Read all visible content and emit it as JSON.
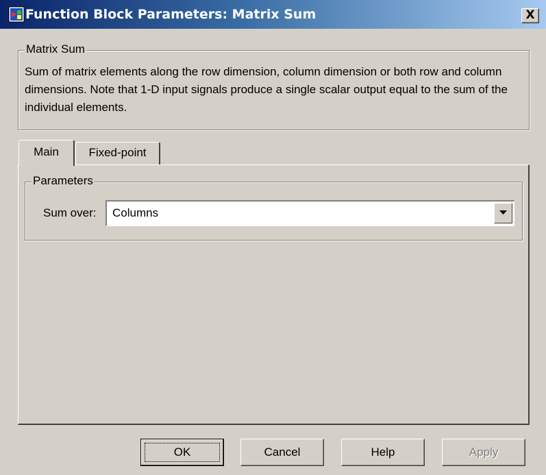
{
  "window": {
    "title": "Function Block Parameters: Matrix Sum",
    "icon": "simulink-block-icon",
    "close_label": "X",
    "colors": {
      "titlebar_start": "#0a246a",
      "titlebar_end": "#a6caf0",
      "face": "#d4d0c8"
    }
  },
  "description_group": {
    "legend": "Matrix Sum",
    "text": "Sum of matrix elements along the row dimension, column dimension or both row and column dimensions. Note that 1-D input signals produce a single scalar output equal to the sum of the individual elements."
  },
  "tabs": [
    {
      "label": "Main",
      "active": true
    },
    {
      "label": "Fixed-point",
      "active": false
    }
  ],
  "parameters": {
    "legend": "Parameters",
    "sum_over_label": "Sum over:",
    "sum_over_value": "Columns"
  },
  "buttons": {
    "ok": "OK",
    "cancel": "Cancel",
    "help": "Help",
    "apply": "Apply"
  }
}
